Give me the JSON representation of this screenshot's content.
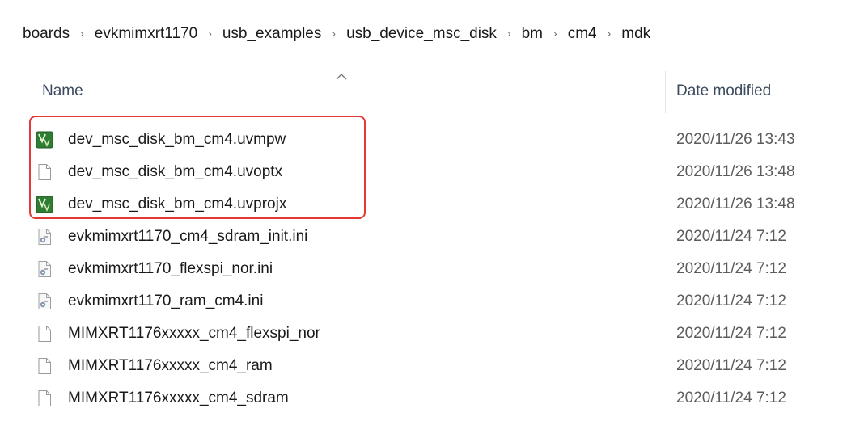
{
  "breadcrumb": {
    "items": [
      {
        "label": "boards"
      },
      {
        "label": "evkmimxrt1170"
      },
      {
        "label": "usb_examples"
      },
      {
        "label": "usb_device_msc_disk"
      },
      {
        "label": "bm"
      },
      {
        "label": "cm4"
      },
      {
        "label": "mdk"
      }
    ],
    "separator": "›"
  },
  "header": {
    "name_label": "Name",
    "date_label": "Date modified",
    "sort": "ascending"
  },
  "files": [
    {
      "name": "dev_msc_disk_bm_cm4.uvmpw",
      "date": "2020/11/26 13:43",
      "icon": "keil-uvision-icon"
    },
    {
      "name": "dev_msc_disk_bm_cm4.uvoptx",
      "date": "2020/11/26 13:48",
      "icon": "blank-file-icon"
    },
    {
      "name": "dev_msc_disk_bm_cm4.uvprojx",
      "date": "2020/11/26 13:48",
      "icon": "keil-uvision-icon"
    },
    {
      "name": "evkmimxrt1170_cm4_sdram_init.ini",
      "date": "2020/11/24 7:12",
      "icon": "ini-settings-file-icon"
    },
    {
      "name": "evkmimxrt1170_flexspi_nor.ini",
      "date": "2020/11/24 7:12",
      "icon": "ini-settings-file-icon"
    },
    {
      "name": "evkmimxrt1170_ram_cm4.ini",
      "date": "2020/11/24 7:12",
      "icon": "ini-settings-file-icon"
    },
    {
      "name": "MIMXRT1176xxxxx_cm4_flexspi_nor",
      "date": "2020/11/24 7:12",
      "icon": "blank-file-icon"
    },
    {
      "name": "MIMXRT1176xxxxx_cm4_ram",
      "date": "2020/11/24 7:12",
      "icon": "blank-file-icon"
    },
    {
      "name": "MIMXRT1176xxxxx_cm4_sdram",
      "date": "2020/11/24 7:12",
      "icon": "blank-file-icon"
    }
  ],
  "colors": {
    "highlight_border": "#e53935",
    "keil_green": "#2f7d32",
    "header_text": "#3c4a5e"
  }
}
